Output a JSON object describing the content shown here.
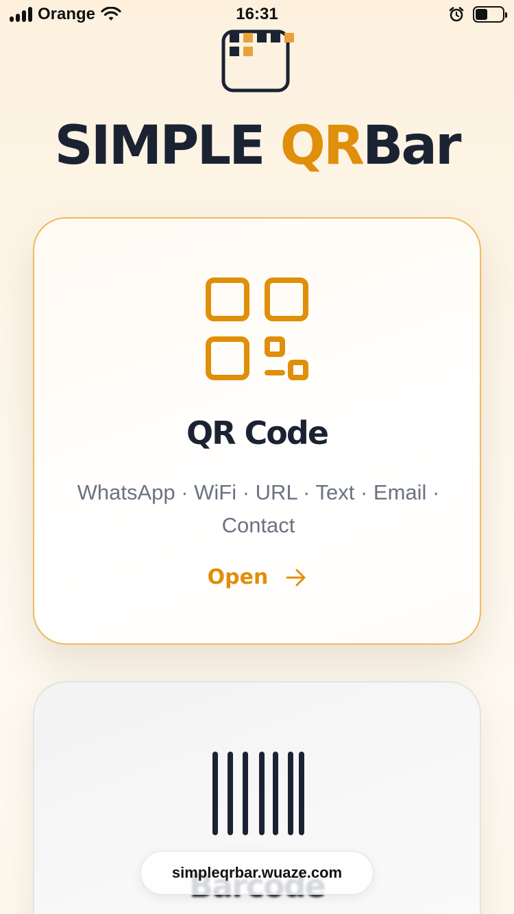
{
  "status_bar": {
    "carrier": "Orange",
    "time": "16:31",
    "battery_level": 0.45
  },
  "brand": {
    "part1": "SIMPLE ",
    "part2": "QR",
    "part3": "Bar"
  },
  "qr_card": {
    "title": "QR Code",
    "description": "WhatsApp · WiFi · URL · Text · Email · Contact",
    "open_label": "Open"
  },
  "barcode_card": {
    "title": "Barcode"
  },
  "browser": {
    "url": "simpleqrbar.wuaze.com"
  },
  "colors": {
    "accent": "#e08f0a",
    "text": "#1b2333",
    "muted": "#6b7280",
    "card_border": "#efb860"
  }
}
